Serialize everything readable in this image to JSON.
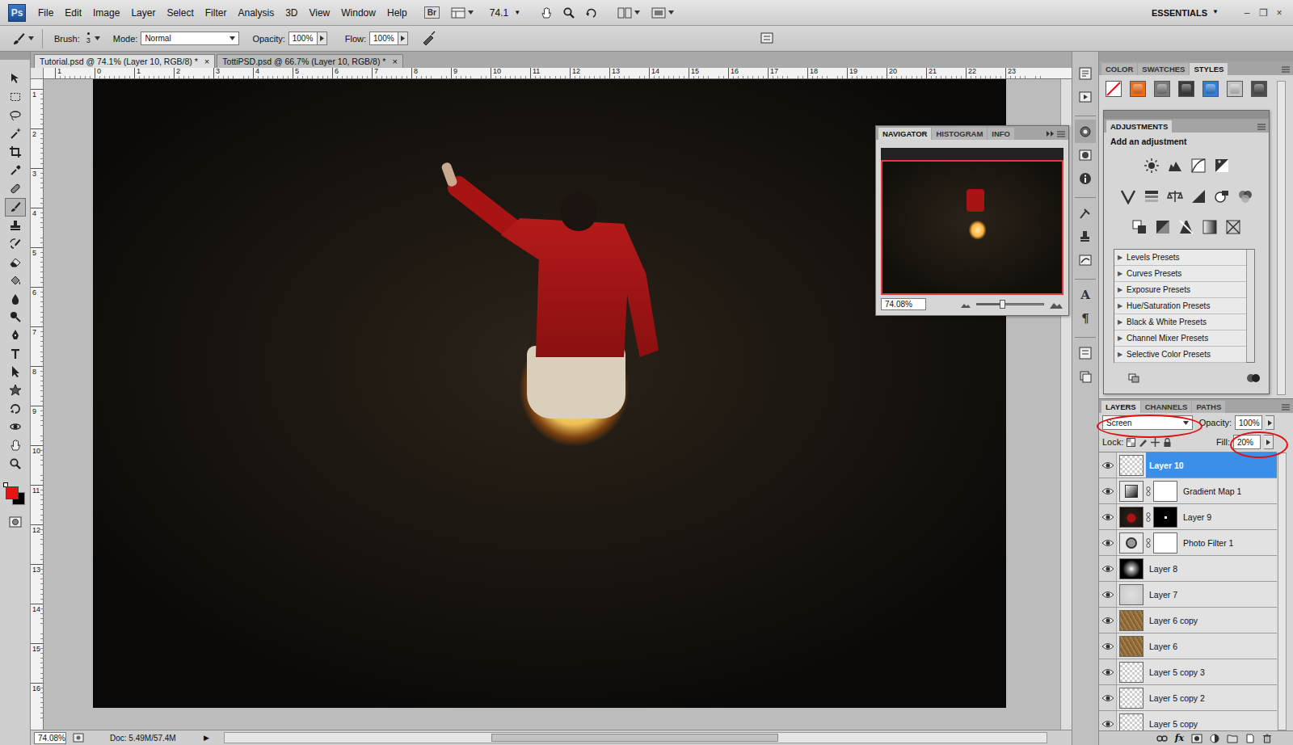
{
  "app": {
    "logo": "Ps",
    "bridge": "Br",
    "zoom": "74.1",
    "zoom_arrow": "▼",
    "workspace": "ESSENTIALS",
    "workspace_arrow": "▼"
  },
  "menu": [
    "File",
    "Edit",
    "Image",
    "Layer",
    "Select",
    "Filter",
    "Analysis",
    "3D",
    "View",
    "Window",
    "Help"
  ],
  "window_controls": [
    "–",
    "❐",
    "×"
  ],
  "options": {
    "brush_label": "Brush:",
    "brush_size": "3",
    "mode_label": "Mode:",
    "mode": "Normal",
    "opacity_label": "Opacity:",
    "opacity": "100%",
    "flow_label": "Flow:",
    "flow": "100%"
  },
  "tools": [
    {
      "selected": false
    },
    {
      "selected": false
    },
    {
      "selected": false
    },
    {
      "selected": false
    },
    {
      "selected": false
    },
    {
      "selected": false
    },
    {
      "selected": false
    },
    {
      "selected": true
    },
    {
      "selected": false
    },
    {
      "selected": false
    },
    {
      "selected": false
    },
    {
      "selected": false
    },
    {
      "selected": false
    },
    {
      "selected": false
    },
    {
      "selected": false
    },
    {
      "selected": false
    },
    {
      "selected": false
    },
    {
      "selected": false
    },
    {
      "selected": false
    },
    {
      "selected": false
    },
    {
      "selected": false
    },
    {
      "selected": false
    }
  ],
  "colors": {
    "foreground": "#e81414",
    "background": "#000000"
  },
  "documents": [
    {
      "title": "Tutorial.psd @ 74.1% (Layer 10, RGB/8) *",
      "close": "×",
      "selected": true
    },
    {
      "title": "TottiPSD.psd @ 66.7% (Layer 10, RGB/8) *",
      "close": "×",
      "selected": false
    }
  ],
  "rulers": {
    "horizontal": [
      "1",
      "0",
      "1",
      "2",
      "3",
      "4",
      "5",
      "6",
      "7",
      "8",
      "9",
      "10",
      "11",
      "12",
      "13",
      "14",
      "15",
      "16",
      "17",
      "18",
      "19",
      "20",
      "21",
      "22",
      "23"
    ],
    "vertical": [
      "1",
      "2",
      "3",
      "4",
      "5",
      "6",
      "7",
      "8",
      "9",
      "10",
      "11",
      "12",
      "13",
      "14",
      "15",
      "16"
    ]
  },
  "navigator": {
    "tabs": [
      {
        "label": "NAVIGATOR",
        "selected": true
      },
      {
        "label": "HISTOGRAM",
        "selected": false
      },
      {
        "label": "INFO",
        "selected": false
      }
    ],
    "zoom": "74.08%",
    "level": 0.38
  },
  "status_bar": {
    "zoom": "74.08%",
    "doc": "Doc: 5.49M/57.4M",
    "arrow": "▶"
  },
  "dock_glyphs": [
    "A",
    "¶"
  ],
  "styles_panel": {
    "tabs": [
      {
        "label": "COLOR",
        "selected": false
      },
      {
        "label": "SWATCHES",
        "selected": false
      },
      {
        "label": "STYLES",
        "selected": true
      }
    ],
    "swatches": [
      {
        "kind": "none",
        "color": "#ffffff"
      },
      {
        "kind": "style",
        "color": "#f26a10"
      },
      {
        "kind": "style",
        "color": "#7a7a7a"
      },
      {
        "kind": "style",
        "color": "#3a3a3a"
      },
      {
        "kind": "style",
        "color": "#2f7fd6"
      },
      {
        "kind": "style",
        "color": "#c4c4c4"
      },
      {
        "kind": "style",
        "color": "#4d4d4d"
      }
    ]
  },
  "adjustments": {
    "title": "ADJUSTMENTS",
    "subtitle": "Add an adjustment",
    "expander": "▶",
    "presets": [
      {
        "label": "Levels Presets",
        "expanded": false
      },
      {
        "label": "Curves Presets",
        "expanded": false
      },
      {
        "label": "Exposure Presets",
        "expanded": false
      },
      {
        "label": "Hue/Saturation Presets",
        "expanded": false
      },
      {
        "label": "Black & White Presets",
        "expanded": false
      },
      {
        "label": "Channel Mixer Presets",
        "expanded": false
      },
      {
        "label": "Selective Color Presets",
        "expanded": false
      }
    ]
  },
  "layers_panel": {
    "tabs": [
      {
        "label": "LAYERS",
        "selected": true
      },
      {
        "label": "CHANNELS",
        "selected": false
      },
      {
        "label": "PATHS",
        "selected": false
      }
    ],
    "blend_mode": "Screen",
    "opacity_label": "Opacity:",
    "opacity": "100%",
    "lock_label": "Lock:",
    "fill_label": "Fill:",
    "fill": "20%",
    "footer_fx": "fx",
    "layers": [
      {
        "name": "Layer 10",
        "kind": "transparent",
        "visible": true,
        "selected": true
      },
      {
        "name": "Gradient Map 1",
        "kind": "gradient-map",
        "visible": true,
        "selected": false
      },
      {
        "name": "Layer 9",
        "kind": "masked",
        "visible": true,
        "selected": false
      },
      {
        "name": "Photo Filter 1",
        "kind": "photo-filter",
        "visible": true,
        "selected": false
      },
      {
        "name": "Layer 8",
        "kind": "radial",
        "visible": true,
        "selected": false
      },
      {
        "name": "Layer 7",
        "kind": "light",
        "visible": true,
        "selected": false
      },
      {
        "name": "Layer 6 copy",
        "kind": "texture",
        "visible": true,
        "selected": false
      },
      {
        "name": "Layer 6",
        "kind": "texture",
        "visible": true,
        "selected": false
      },
      {
        "name": "Layer 5 copy 3",
        "kind": "transparent",
        "visible": true,
        "selected": false
      },
      {
        "name": "Layer 5 copy 2",
        "kind": "transparent",
        "visible": true,
        "selected": false
      },
      {
        "name": "Layer 5 copy",
        "kind": "transparent",
        "visible": true,
        "selected": false
      }
    ]
  }
}
